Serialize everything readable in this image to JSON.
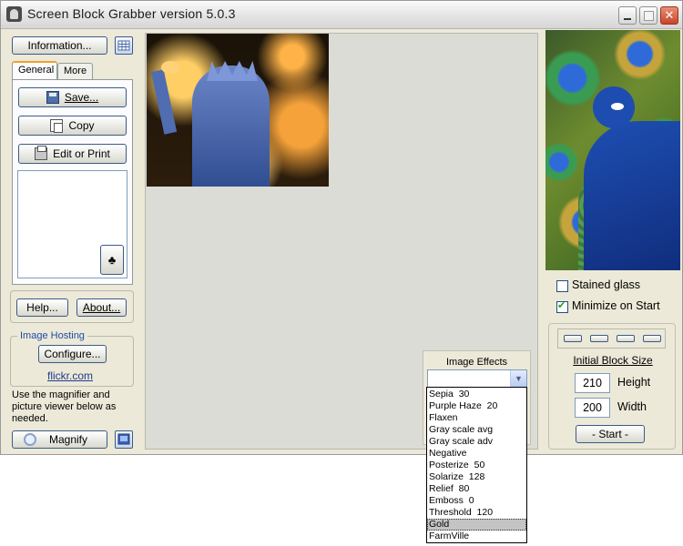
{
  "window": {
    "title": "Screen Block Grabber   version 5.0.3"
  },
  "left": {
    "information_label": "Information...",
    "tabs": [
      {
        "label": "General",
        "active": true
      },
      {
        "label": "More",
        "active": false
      }
    ],
    "save_label": "Save...",
    "copy_label": "Copy",
    "edit_print_label": "Edit or Print",
    "clubs_glyph": "♣",
    "help_label": "Help...",
    "about_label": "About...",
    "image_hosting": {
      "legend": "Image Hosting",
      "configure_label": "Configure...",
      "link": "flickr.com"
    },
    "hint": "Use the magnifier and picture viewer below as needed.",
    "magnify_label": "Magnify"
  },
  "effects": {
    "title": "Image Effects",
    "selected_value": "",
    "options": [
      "Sepia  30",
      "Purple Haze  20",
      "Flaxen",
      "Gray scale avg",
      "Gray scale adv",
      "Negative",
      "Posterize  50",
      "Solarize  128",
      "Relief  80",
      "Emboss  0",
      "Threshold  120",
      "Gold",
      "FarmVille"
    ],
    "highlighted": "Gold"
  },
  "right": {
    "stained_glass": {
      "label": "Stained glass",
      "checked": false
    },
    "minimize_on_start": {
      "label": "Minimize on Start",
      "checked": true
    },
    "block_size": {
      "title": "Initial Block Size",
      "height_value": "210",
      "height_label": "Height",
      "width_value": "200",
      "width_label": "Width"
    },
    "start_label": "- Start -"
  },
  "icons": {
    "close": "close-icon",
    "minimize": "minimize-icon",
    "maximize": "maximize-icon",
    "save": "floppy-disk-icon",
    "copy": "copy-icon",
    "print": "printer-icon",
    "grid": "grid-icon",
    "magnifier": "magnifier-icon",
    "monitor": "monitor-icon"
  },
  "colors": {
    "window_bg": "#ece9d8",
    "canvas_bg": "#dcdcd6",
    "accent_border": "#3c5a86",
    "link": "#1f3b8f"
  }
}
